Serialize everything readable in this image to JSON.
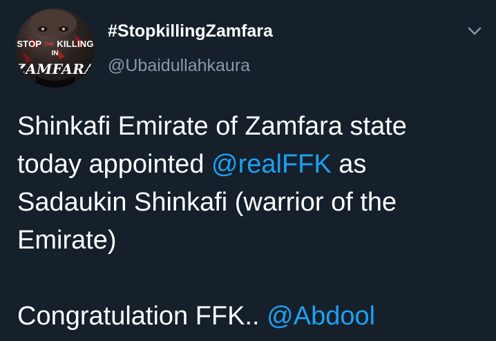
{
  "tweet": {
    "author": {
      "display_name": "#StopkillingZamfara",
      "handle": "@Ubaidullahkaura",
      "avatar": {
        "line1_a": "STOP",
        "line1_b": "THE",
        "line1_c": "KILLING",
        "line2": "IN",
        "line3": "ZAMFARA"
      }
    },
    "menu_icon": "chevron-down-icon",
    "body": {
      "line1": "Shinkafi Emirate of Zamfara state",
      "line2_a": "today appointed ",
      "line2_mention": "@realFFK",
      "line2_b": " as",
      "line3": "Sadaukin Shinkafi (warrior of the",
      "line4": "Emirate)",
      "line6_a": "Congratulation FFK.. ",
      "line6_mention": "@Abdool"
    }
  },
  "colors": {
    "background": "#15202b",
    "text": "#ffffff",
    "secondary": "#8899a6",
    "link": "#1da1f2"
  }
}
